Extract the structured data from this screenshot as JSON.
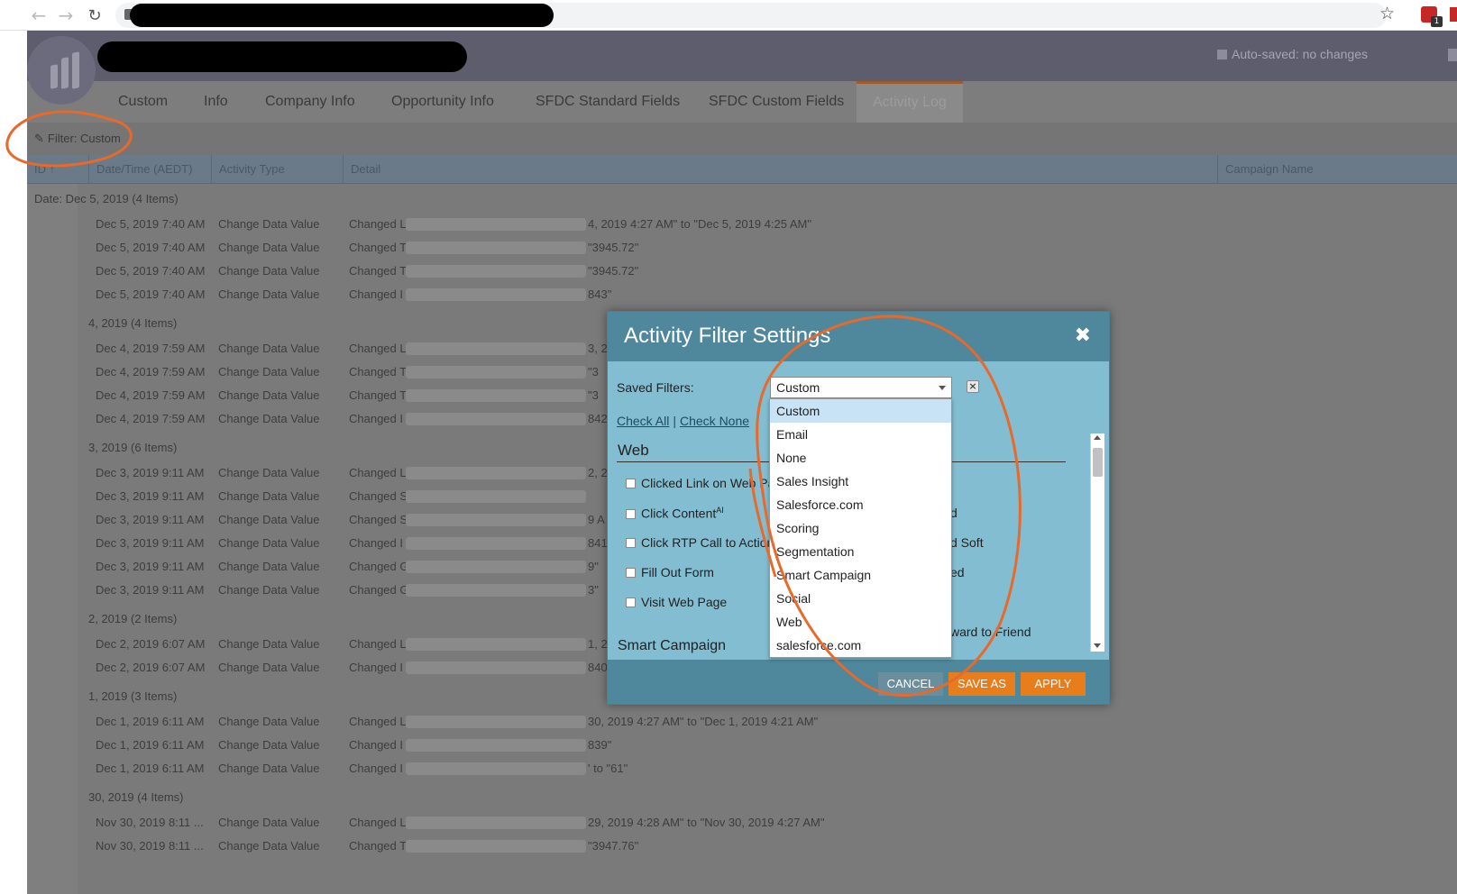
{
  "browser": {
    "url_redacted": true
  },
  "header": {
    "autosave": "Auto-saved: no changes"
  },
  "tabs": [
    {
      "label": "Custom"
    },
    {
      "label": "Info"
    },
    {
      "label": "Company Info"
    },
    {
      "label": "Opportunity Info"
    },
    {
      "label": "SFDC Standard Fields"
    },
    {
      "label": "SFDC Custom Fields"
    },
    {
      "label": "Activity Log",
      "active": true
    }
  ],
  "filterbar": {
    "label": "Filter: Custom"
  },
  "grid": {
    "columns": [
      "ID ↑",
      "Date/Time (AEDT)",
      "Activity Type",
      "Detail",
      "Campaign Name"
    ],
    "groups": [
      {
        "label": "Date: Dec 5, 2019 (4 Items)",
        "rows": [
          {
            "datetime": "Dec 5, 2019 7:40 AM",
            "type": "Change Data Value",
            "detail_start": "Changed L",
            "detail_end": "4, 2019 4:27 AM\" to \"Dec 5, 2019 4:25 AM\""
          },
          {
            "datetime": "Dec 5, 2019 7:40 AM",
            "type": "Change Data Value",
            "detail_start": "Changed T",
            "detail_end": "\"3945.72\""
          },
          {
            "datetime": "Dec 5, 2019 7:40 AM",
            "type": "Change Data Value",
            "detail_start": "Changed T",
            "detail_end": "\"3945.72\""
          },
          {
            "datetime": "Dec 5, 2019 7:40 AM",
            "type": "Change Data Value",
            "detail_start": "Changed I",
            "detail_end": "843\""
          }
        ]
      },
      {
        "label": "4, 2019 (4 Items)",
        "rows": [
          {
            "datetime": "Dec 4, 2019 7:59 AM",
            "type": "Change Data Value",
            "detail_start": "Changed L",
            "detail_end": "3, 2"
          },
          {
            "datetime": "Dec 4, 2019 7:59 AM",
            "type": "Change Data Value",
            "detail_start": "Changed T",
            "detail_end": "\"3"
          },
          {
            "datetime": "Dec 4, 2019 7:59 AM",
            "type": "Change Data Value",
            "detail_start": "Changed T",
            "detail_end": "\"3"
          },
          {
            "datetime": "Dec 4, 2019 7:59 AM",
            "type": "Change Data Value",
            "detail_start": "Changed I",
            "detail_end": "842"
          }
        ]
      },
      {
        "label": "3, 2019 (6 Items)",
        "rows": [
          {
            "datetime": "Dec 3, 2019 9:11 AM",
            "type": "Change Data Value",
            "detail_start": "Changed L",
            "detail_end": "2, 2"
          },
          {
            "datetime": "Dec 3, 2019 9:11 AM",
            "type": "Change Data Value",
            "detail_start": "Changed S",
            "detail_end": ""
          },
          {
            "datetime": "Dec 3, 2019 9:11 AM",
            "type": "Change Data Value",
            "detail_start": "Changed S",
            "detail_end": "9 A"
          },
          {
            "datetime": "Dec 3, 2019 9:11 AM",
            "type": "Change Data Value",
            "detail_start": "Changed I",
            "detail_end": "841"
          },
          {
            "datetime": "Dec 3, 2019 9:11 AM",
            "type": "Change Data Value",
            "detail_start": "Changed G",
            "detail_end": "9\""
          },
          {
            "datetime": "Dec 3, 2019 9:11 AM",
            "type": "Change Data Value",
            "detail_start": "Changed G",
            "detail_end": "3\""
          }
        ]
      },
      {
        "label": "2, 2019 (2 Items)",
        "rows": [
          {
            "datetime": "Dec 2, 2019 6:07 AM",
            "type": "Change Data Value",
            "detail_start": "Changed L",
            "detail_end": "1, 2"
          },
          {
            "datetime": "Dec 2, 2019 6:07 AM",
            "type": "Change Data Value",
            "detail_start": "Changed I",
            "detail_end": "840"
          }
        ]
      },
      {
        "label": "1, 2019 (3 Items)",
        "rows": [
          {
            "datetime": "Dec 1, 2019 6:11 AM",
            "type": "Change Data Value",
            "detail_start": "Changed L",
            "detail_end": "30, 2019 4:27 AM\" to \"Dec 1, 2019 4:21 AM\""
          },
          {
            "datetime": "Dec 1, 2019 6:11 AM",
            "type": "Change Data Value",
            "detail_start": "Changed I",
            "detail_end": "839\""
          },
          {
            "datetime": "Dec 1, 2019 6:11 AM",
            "type": "Change Data Value",
            "detail_start": "Changed I",
            "detail_end": "' to \"61\""
          }
        ]
      },
      {
        "label": "30, 2019 (4 Items)",
        "rows": [
          {
            "datetime": "Nov 30, 2019 8:11 ...",
            "type": "Change Data Value",
            "detail_start": "Changed L",
            "detail_end": "29, 2019 4:28 AM\" to \"Nov 30, 2019 4:27 AM\""
          },
          {
            "datetime": "Nov 30, 2019 8:11 ...",
            "type": "Change Data Value",
            "detail_start": "Changed T",
            "detail_end": "\"3947.76\""
          }
        ]
      }
    ]
  },
  "modal": {
    "title": "Activity Filter Settings",
    "saved_filters_label": "Saved Filters:",
    "selected_filter": "Custom",
    "check_all": "Check All",
    "check_none": "Check None",
    "sections": [
      {
        "title": "Web",
        "items": [
          {
            "label": "Clicked Link on Web Pa"
          },
          {
            "label": "Click Content",
            "sup": "AI"
          },
          {
            "label": "Click RTP Call to Action"
          },
          {
            "label": "Fill Out Form"
          },
          {
            "label": "Visit Web Page"
          }
        ]
      },
      {
        "title": "Smart Campaign",
        "items": []
      }
    ],
    "right_col_fragments": [
      "d",
      "d Soft",
      "ed",
      "ward to Friend"
    ],
    "buttons": {
      "cancel": "CANCEL",
      "save_as": "SAVE AS",
      "apply": "APPLY"
    }
  },
  "dropdown": {
    "options": [
      "Custom",
      "Email",
      "None",
      "Sales Insight",
      "Salesforce.com",
      "Scoring",
      "Segmentation",
      "Smart Campaign",
      "Social",
      "Web",
      "salesforce.com"
    ],
    "highlighted": "Custom"
  },
  "colors": {
    "accent_orange": "#e87d1c",
    "modal_header": "#4f879c",
    "modal_body": "#82bdd1",
    "annotation": "#e8692a"
  }
}
